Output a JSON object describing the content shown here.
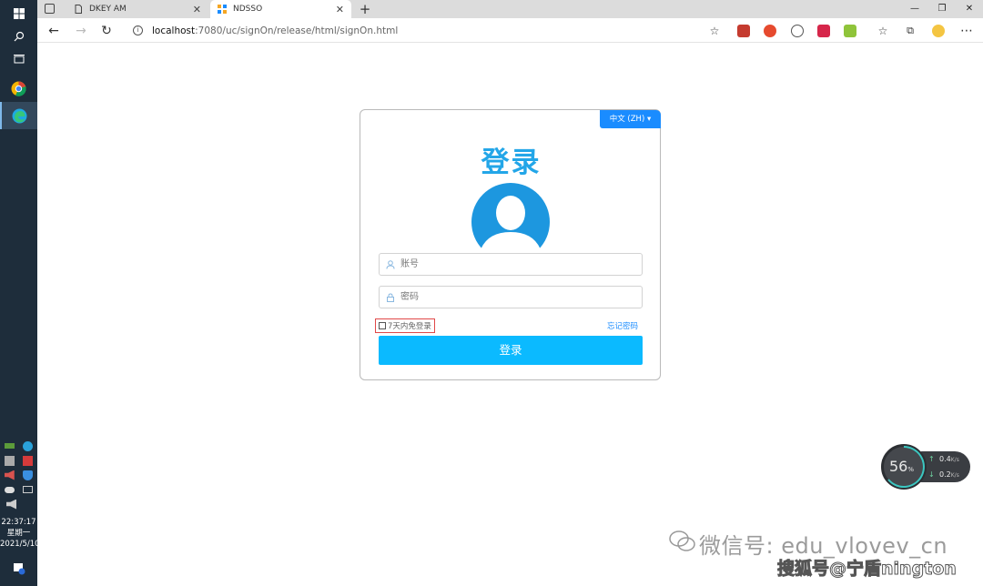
{
  "browser": {
    "tabs": [
      {
        "label": "DKEY AM",
        "active": false
      },
      {
        "label": "NDSSO",
        "active": true
      }
    ],
    "address": {
      "host": "localhost",
      "path": ":7080/uc/signOn/release/html/signOn.html"
    }
  },
  "login": {
    "language_label": "中文 (ZH)",
    "title": "登录",
    "username_placeholder": "账号",
    "password_placeholder": "密码",
    "remember_label": "7天内免登录",
    "forgot_label": "忘记密码",
    "submit_label": "登录"
  },
  "taskbar": {
    "time": "22:37:17",
    "weekday": "星期一",
    "date": "2021/5/10"
  },
  "netmon": {
    "percent": "56",
    "percent_unit": "%",
    "upload": "0.4",
    "download": "0.2",
    "unit": "K/s"
  },
  "watermark": {
    "line1": "微信号: edu_vlovev_cn",
    "line2": "搜狐号@宁盾nington"
  },
  "colors": {
    "accent": "#1a8cff",
    "title": "#23a6e8",
    "submit": "#0bbaff",
    "avatar": "#1d97df"
  }
}
